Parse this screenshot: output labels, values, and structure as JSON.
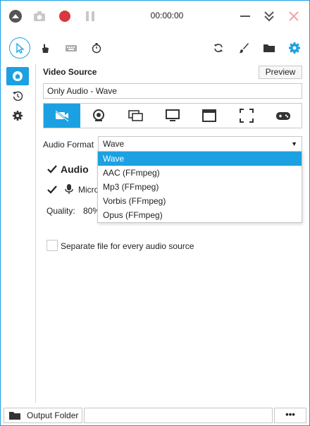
{
  "colors": {
    "accent": "#1ba1e2",
    "record": "#d9363e",
    "icon": "#3a3a3a",
    "close": "#f4a3a3"
  },
  "titlebar": {
    "timer": "00:00:00"
  },
  "toolbar": {
    "icons": [
      "cursor-icon",
      "hand-icon",
      "keyboard-icon",
      "stopwatch-icon",
      "refresh-icon",
      "brush-icon",
      "folder-icon",
      "gear-icon"
    ]
  },
  "nav": {
    "items": [
      "home-icon",
      "history-icon",
      "settings-icon"
    ]
  },
  "video_source": {
    "title": "Video Source",
    "preview_label": "Preview",
    "current": "Only Audio  -  Wave"
  },
  "audio_format": {
    "label": "Audio Format",
    "selected": "Wave",
    "options": [
      "Wave",
      "AAC (FFmpeg)",
      "Mp3 (FFmpeg)",
      "Vorbis (FFmpeg)",
      "Opus (FFmpeg)"
    ]
  },
  "audio": {
    "title": "Audio",
    "microphone_label": "Micro",
    "quality_label": "Quality:",
    "quality_value": "80%"
  },
  "separate_file_label": "Separate file for every audio source",
  "bottom": {
    "output_folder_label": "Output Folder",
    "more_label": "•••"
  }
}
